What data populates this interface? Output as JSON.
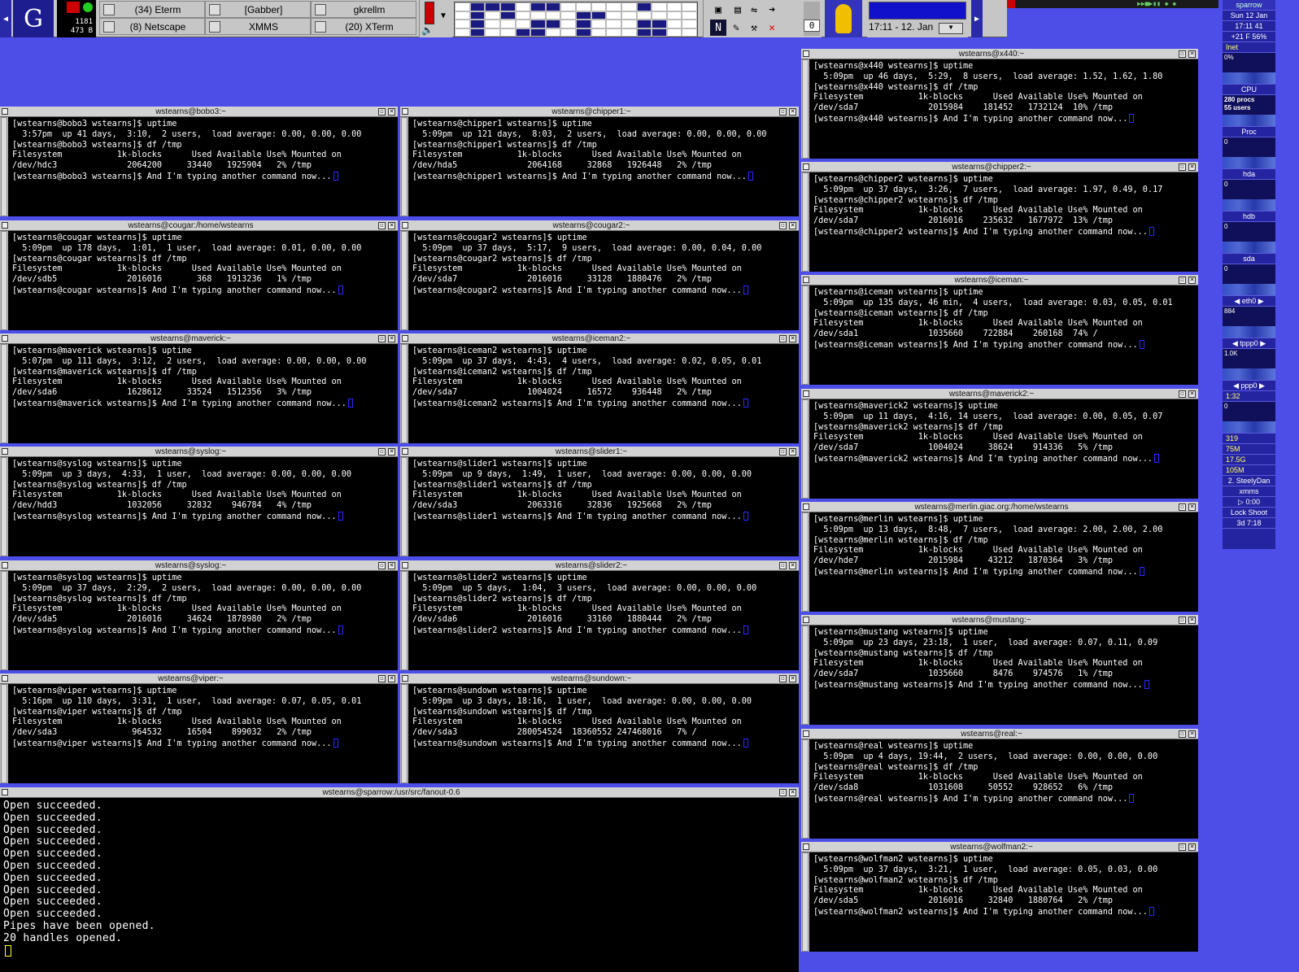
{
  "panel": {
    "netmon": {
      "rx": "1181",
      "tx": "473 B"
    },
    "tasks": [
      {
        "label": "(34) Eterm",
        "icon": "window-icon"
      },
      {
        "label": "[Gabber]",
        "icon": "gabber-icon"
      },
      {
        "label": "gkrellm",
        "icon": "window-icon"
      },
      {
        "label": "(8) Netscape",
        "icon": "netscape-icon"
      },
      {
        "label": "XMMS",
        "icon": "xmms-icon"
      },
      {
        "label": "(20) XTerm",
        "icon": "window-icon"
      }
    ],
    "mail_count": "0",
    "clock": "17:11 - 12. Jan",
    "colors": {
      "desktop": "#4d4de8",
      "panel": "#c6c6c6",
      "pager_active": "#1a1a80"
    }
  },
  "gkrellm": {
    "host": "sparrow",
    "date": "Sun 12 Jan",
    "time": "17:11",
    "seconds": "41",
    "temp": "+21 F",
    "pct": "56%",
    "inet": "Inet",
    "cpu_pct": "0%",
    "cpu": "CPU",
    "procs": "280 procs",
    "users": "55 users",
    "proc": "Proc",
    "hda": "hda",
    "hdb": "hdb",
    "sda": "sda",
    "eth0": "eth0",
    "eth0_val": "884",
    "tppp0": "tppp0",
    "tppp0_val": "1.0K",
    "ppp0": "ppp0",
    "ppp0_time": "1:32",
    "mem1": "319",
    "mem2": "75M",
    "mem3": "17.5G",
    "mem4": "105M",
    "xmms_track": "2. SteelyDan",
    "xmms": "xmms",
    "xmms_time": "0:00",
    "lock": "Lock",
    "shoot": "Shoot",
    "uptime": "3d 7:18",
    "zero": "0"
  },
  "xterms": [
    {
      "title": "wstearns@bobo3:~",
      "lines": [
        "[wstearns@bobo3 wstearns]$ uptime",
        "  3:57pm  up 41 days,  3:10,  2 users,  load average: 0.00, 0.00, 0.00",
        "[wstearns@bobo3 wstearns]$ df /tmp",
        "Filesystem           1k-blocks      Used Available Use% Mounted on",
        "/dev/hdc3              2064200     33440   1925904   2% /tmp",
        "[wstearns@bobo3 wstearns]$ And I'm typing another command now..."
      ]
    },
    {
      "title": "wstearns@chipper1:~",
      "lines": [
        "[wstearns@chipper1 wstearns]$ uptime",
        "  5:09pm  up 121 days,  8:03,  2 users,  load average: 0.00, 0.00, 0.00",
        "[wstearns@chipper1 wstearns]$ df /tmp",
        "Filesystem           1k-blocks      Used Available Use% Mounted on",
        "/dev/hda5              2064168     32868   1926448   2% /tmp",
        "[wstearns@chipper1 wstearns]$ And I'm typing another command now..."
      ]
    },
    {
      "title": "wstearns@x440:~",
      "lines": [
        "[wstearns@x440 wstearns]$ uptime",
        "  5:09pm  up 46 days,  5:29,  8 users,  load average: 1.52, 1.62, 1.80",
        "[wstearns@x440 wstearns]$ df /tmp",
        "Filesystem           1k-blocks      Used Available Use% Mounted on",
        "/dev/sda7              2015984    181452   1732124  10% /tmp",
        "[wstearns@x440 wstearns]$ And I'm typing another command now..."
      ]
    },
    {
      "title": "wstearns@chipper2:~",
      "lines": [
        "[wstearns@chipper2 wstearns]$ uptime",
        "  5:09pm  up 37 days,  3:26,  7 users,  load average: 1.97, 0.49, 0.17",
        "[wstearns@chipper2 wstearns]$ df /tmp",
        "Filesystem           1k-blocks      Used Available Use% Mounted on",
        "/dev/sda7              2016016    235632   1677972  13% /tmp",
        "[wstearns@chipper2 wstearns]$ And I'm typing another command now..."
      ]
    },
    {
      "title": "wstearns@cougar:/home/wstearns",
      "lines": [
        "[wstearns@cougar wstearns]$ uptime",
        "  5:09pm  up 178 days,  1:01,  1 user,  load average: 0.01, 0.00, 0.00",
        "[wstearns@cougar wstearns]$ df /tmp",
        "Filesystem           1k-blocks      Used Available Use% Mounted on",
        "/dev/sdb5              2016016       368   1913236   1% /tmp",
        "[wstearns@cougar wstearns]$ And I'm typing another command now..."
      ]
    },
    {
      "title": "wstearns@cougar2:~",
      "lines": [
        "[wstearns@cougar2 wstearns]$ uptime",
        "  5:09pm  up 37 days,  5:17,  9 users,  load average: 0.00, 0.04, 0.00",
        "[wstearns@cougar2 wstearns]$ df /tmp",
        "Filesystem           1k-blocks      Used Available Use% Mounted on",
        "/dev/sda7              2016016     33128   1880476   2% /tmp",
        "[wstearns@cougar2 wstearns]$ And I'm typing another command now..."
      ]
    },
    {
      "title": "wstearns@iceman:~",
      "lines": [
        "[wstearns@iceman wstearns]$ uptime",
        "  5:09pm  up 135 days, 46 min,  4 users,  load average: 0.03, 0.05, 0.01",
        "[wstearns@iceman wstearns]$ df /tmp",
        "Filesystem           1k-blocks      Used Available Use% Mounted on",
        "/dev/sda1              1035660    722884    260168  74% /",
        "[wstearns@iceman wstearns]$ And I'm typing another command now..."
      ]
    },
    {
      "title": "wstearns@maverick:~",
      "lines": [
        "[wstearns@maverick wstearns]$ uptime",
        "  5:07pm  up 111 days,  3:12,  2 users,  load average: 0.00, 0.00, 0.00",
        "[wstearns@maverick wstearns]$ df /tmp",
        "Filesystem           1k-blocks      Used Available Use% Mounted on",
        "/dev/sda6              1628612     33524   1512356   3% /tmp",
        "[wstearns@maverick wstearns]$ And I'm typing another command now..."
      ]
    },
    {
      "title": "wstearns@iceman2:~",
      "lines": [
        "[wstearns@iceman2 wstearns]$ uptime",
        "  5:09pm  up 37 days,  4:43,  4 users,  load average: 0.02, 0.05, 0.01",
        "[wstearns@iceman2 wstearns]$ df /tmp",
        "Filesystem           1k-blocks      Used Available Use% Mounted on",
        "/dev/sda7              1004024     16572    936448   2% /tmp",
        "[wstearns@iceman2 wstearns]$ And I'm typing another command now..."
      ]
    },
    {
      "title": "wstearns@maverick2:~",
      "lines": [
        "[wstearns@maverick2 wstearns]$ uptime",
        "  5:09pm  up 11 days,  4:16, 14 users,  load average: 0.00, 0.05, 0.07",
        "[wstearns@maverick2 wstearns]$ df /tmp",
        "Filesystem           1k-blocks      Used Available Use% Mounted on",
        "/dev/sda7              1004024     38624    914336   5% /tmp",
        "[wstearns@maverick2 wstearns]$ And I'm typing another command now..."
      ]
    },
    {
      "title": "wstearns@syslog:~",
      "lines": [
        "[wstearns@syslog wstearns]$ uptime",
        "  5:09pm  up 3 days,  4:33,  1 user,  load average: 0.00, 0.00, 0.00",
        "[wstearns@syslog wstearns]$ df /tmp",
        "Filesystem           1k-blocks      Used Available Use% Mounted on",
        "/dev/hdd3              1032056     32832    946784   4% /tmp",
        "[wstearns@syslog wstearns]$ And I'm typing another command now..."
      ]
    },
    {
      "title": "wstearns@slider1:~",
      "lines": [
        "[wstearns@slider1 wstearns]$ uptime",
        "  5:09pm  up 9 days,  1:49,  1 user,  load average: 0.00, 0.00, 0.00",
        "[wstearns@slider1 wstearns]$ df /tmp",
        "Filesystem           1k-blocks      Used Available Use% Mounted on",
        "/dev/sda3              2063316     32836   1925668   2% /tmp",
        "[wstearns@slider1 wstearns]$ And I'm typing another command now..."
      ]
    },
    {
      "title": "wstearns@merlin.giac.org:/home/wstearns",
      "lines": [
        "[wstearns@merlin wstearns]$ uptime",
        "  5:09pm  up 13 days,  8:48,  7 users,  load average: 2.00, 2.00, 2.00",
        "[wstearns@merlin wstearns]$ df /tmp",
        "Filesystem           1k-blocks      Used Available Use% Mounted on",
        "/dev/hde7              2015984     43212   1870364   3% /tmp",
        "[wstearns@merlin wstearns]$ And I'm typing another command now..."
      ]
    },
    {
      "title": "wstearns@syslog:~",
      "lines": [
        "[wstearns@syslog wstearns]$ uptime",
        "  5:09pm  up 37 days,  2:29,  2 users,  load average: 0.00, 0.00, 0.00",
        "[wstearns@syslog wstearns]$ df /tmp",
        "Filesystem           1k-blocks      Used Available Use% Mounted on",
        "/dev/sda5              2016016     34624   1878980   2% /tmp",
        "[wstearns@syslog wstearns]$ And I'm typing another command now..."
      ]
    },
    {
      "title": "wstearns@slider2:~",
      "lines": [
        "[wstearns@slider2 wstearns]$ uptime",
        "  5:09pm  up 5 days,  1:04,  3 users,  load average: 0.00, 0.00, 0.00",
        "[wstearns@slider2 wstearns]$ df /tmp",
        "Filesystem           1k-blocks      Used Available Use% Mounted on",
        "/dev/sda6              2016016     33160   1880444   2% /tmp",
        "[wstearns@slider2 wstearns]$ And I'm typing another command now..."
      ]
    },
    {
      "title": "wstearns@mustang:~",
      "lines": [
        "[wstearns@mustang wstearns]$ uptime",
        "  5:09pm  up 23 days, 23:18,  1 user,  load average: 0.07, 0.11, 0.09",
        "[wstearns@mustang wstearns]$ df /tmp",
        "Filesystem           1k-blocks      Used Available Use% Mounted on",
        "/dev/sda7              1035660      8476    974576   1% /tmp",
        "[wstearns@mustang wstearns]$ And I'm typing another command now..."
      ]
    },
    {
      "title": "wstearns@viper:~",
      "lines": [
        "[wstearns@viper wstearns]$ uptime",
        "  5:16pm  up 110 days,  3:31,  1 user,  load average: 0.07, 0.05, 0.01",
        "[wstearns@viper wstearns]$ df /tmp",
        "Filesystem           1k-blocks      Used Available Use% Mounted on",
        "/dev/sda3               964532     16504    899032   2% /tmp",
        "[wstearns@viper wstearns]$ And I'm typing another command now..."
      ]
    },
    {
      "title": "wstearns@sundown:~",
      "lines": [
        "[wstearns@sundown wstearns]$ uptime",
        "  5:09pm  up 3 days, 18:16,  1 user,  load average: 0.00, 0.00, 0.00",
        "[wstearns@sundown wstearns]$ df /tmp",
        "Filesystem           1k-blocks      Used Available Use% Mounted on",
        "/dev/sda3            280054524  18360552 247468016   7% /",
        "[wstearns@sundown wstearns]$ And I'm typing another command now..."
      ]
    },
    {
      "title": "wstearns@real:~",
      "lines": [
        "[wstearns@real wstearns]$ uptime",
        "  5:09pm  up 4 days, 19:44,  2 users,  load average: 0.00, 0.00, 0.00",
        "[wstearns@real wstearns]$ df /tmp",
        "Filesystem           1k-blocks      Used Available Use% Mounted on",
        "/dev/sda8              1031608     50552    928652   6% /tmp",
        "[wstearns@real wstearns]$ And I'm typing another command now..."
      ]
    },
    {
      "title": "wstearns@wolfman2:~",
      "lines": [
        "[wstearns@wolfman2 wstearns]$ uptime",
        "  5:09pm  up 37 days,  3:21,  1 user,  load average: 0.05, 0.03, 0.00",
        "[wstearns@wolfman2 wstearns]$ df /tmp",
        "Filesystem           1k-blocks      Used Available Use% Mounted on",
        "/dev/sda5              2016016     32840   1880764   2% /tmp",
        "[wstearns@wolfman2 wstearns]$ And I'm typing another command now..."
      ]
    }
  ],
  "fanout": {
    "title": "wstearns@sparrow:/usr/src/fanout-0.6",
    "lines": [
      "Open succeeded.",
      "Open succeeded.",
      "Open succeeded.",
      "Open succeeded.",
      "Open succeeded.",
      "Open succeeded.",
      "Open succeeded.",
      "Open succeeded.",
      "Open succeeded.",
      "Open succeeded.",
      "Pipes have been opened.",
      "20 handles opened."
    ]
  }
}
